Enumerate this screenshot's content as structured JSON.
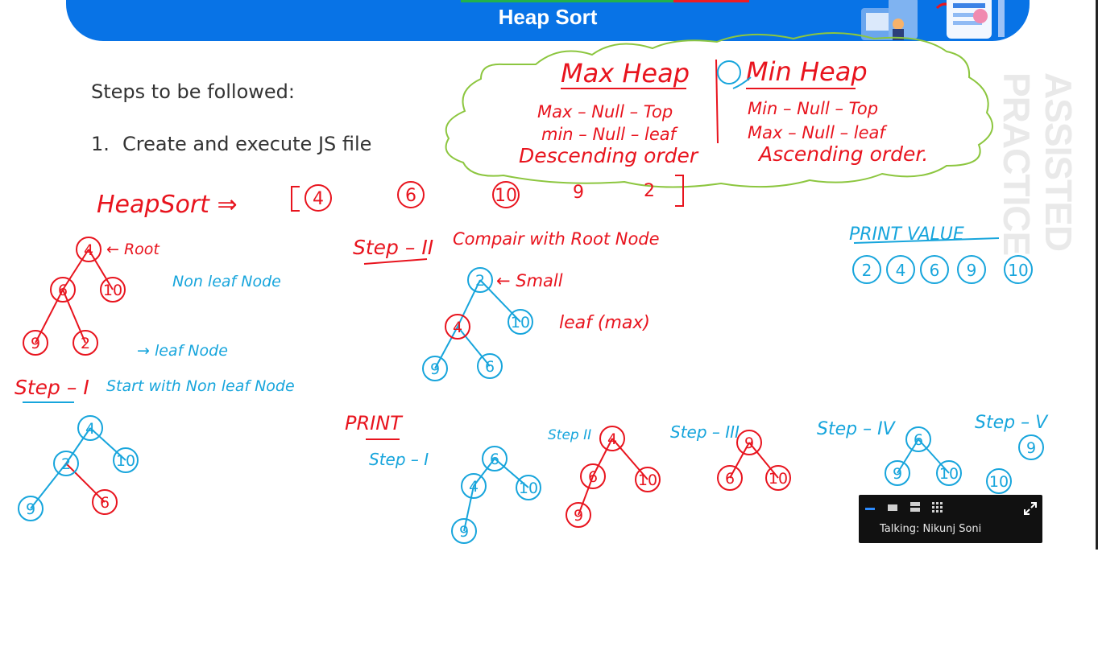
{
  "header": {
    "title": "Heap Sort",
    "accent_colors": [
      "#22b14c",
      "#ed1c24"
    ],
    "illustration": "office-workers-illustration"
  },
  "slide": {
    "steps_heading": "Steps to be followed:",
    "steps": [
      {
        "number": "1.",
        "text": "Create and execute JS file"
      }
    ],
    "watermark": "ASSISTED PRACTICE"
  },
  "annotations": {
    "pen_colors": {
      "red": "#e8141e",
      "blue": "#17a5dc",
      "green": "#8cc63f"
    },
    "cloud": {
      "max_heap_title": "Max Heap",
      "min_heap_title": "Min Heap",
      "max_lines": [
        "Max – Null – Top",
        "min – Null – leaf",
        "Descending order"
      ],
      "min_lines": [
        "Min – Null – Top",
        "Max – Null – leaf",
        "Ascending order."
      ]
    },
    "heapsort_label": "HeapSort ⇒",
    "array": [
      "4",
      "6",
      "10",
      "9",
      "2"
    ],
    "tree1_labels": {
      "root": "← Root",
      "non_leaf": "Non leaf Node",
      "leaf": "→ leaf Node"
    },
    "step1": {
      "label": "Step – I",
      "text": "Start with Non leaf Node"
    },
    "step2": {
      "label": "Step – II",
      "text": "Compair with Root Node",
      "small": "← Small",
      "leaf_max": "leaf (max)"
    },
    "print_section": {
      "label": "PRINT",
      "step1": "Step – I",
      "step2": "Step II",
      "step3": "Step – III",
      "step4": "Step – IV",
      "step5": "Step – V"
    },
    "print_value": {
      "label": "PRINT VALUE",
      "values": [
        "2",
        "4",
        "6",
        "9",
        "10"
      ]
    }
  },
  "meeting_bar": {
    "talking": "Talking: Nikunj Soni",
    "controls": [
      "minimize-icon",
      "single-view-icon",
      "strip-view-icon",
      "grid-view-icon",
      "fullscreen-icon"
    ]
  }
}
